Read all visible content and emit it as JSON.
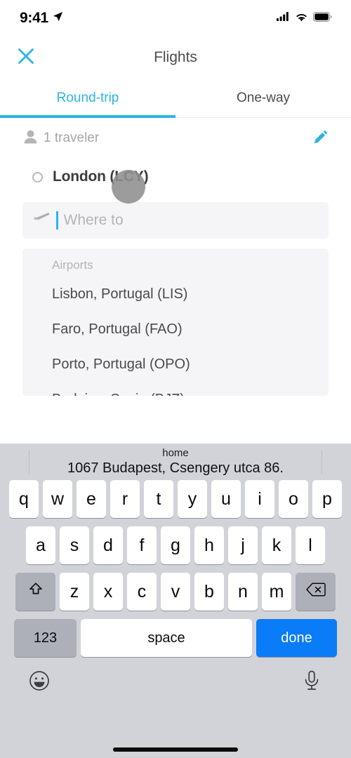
{
  "status_bar": {
    "time": "9:41",
    "location_icon": "location-arrow-icon",
    "cellular_icon": "cellular-signal-icon",
    "wifi_icon": "wifi-icon",
    "battery_icon": "battery-full-icon"
  },
  "nav": {
    "title": "Flights",
    "close_icon": "close-x-icon"
  },
  "tabs": {
    "items": [
      {
        "label": "Round-trip",
        "active": true
      },
      {
        "label": "One-way",
        "active": false
      }
    ],
    "active_color": "#29b6e8",
    "inactive_color": "#4c4c4c"
  },
  "traveler": {
    "icon": "person-icon",
    "label": "1 traveler",
    "edit_icon": "pencil-edit-icon"
  },
  "origin": {
    "marker_icon": "circle-marker-icon",
    "label": "London (LCY)"
  },
  "destination": {
    "icon": "airplane-icon",
    "placeholder": "Where to",
    "value": "",
    "caret_color": "#29b6e8"
  },
  "suggestions": {
    "section_title": "Airports",
    "items": [
      {
        "label": "Lisbon, Portugal (LIS)"
      },
      {
        "label": "Faro, Portugal (FAO)"
      },
      {
        "label": "Porto, Portugal (OPO)"
      },
      {
        "label": "Badajoz, Spain (BJZ)"
      }
    ]
  },
  "keyboard": {
    "suggestion": {
      "title": "home",
      "subtitle": "1067 Budapest, Csengery utca 86."
    },
    "row1": [
      "q",
      "w",
      "e",
      "r",
      "t",
      "y",
      "u",
      "i",
      "o",
      "p"
    ],
    "row2": [
      "a",
      "s",
      "d",
      "f",
      "g",
      "h",
      "j",
      "k",
      "l"
    ],
    "row3": [
      "z",
      "x",
      "c",
      "v",
      "b",
      "n",
      "m"
    ],
    "shift_icon": "shift-arrow-icon",
    "delete_icon": "backspace-delete-icon",
    "numbers_label": "123",
    "space_label": "space",
    "done_label": "done",
    "done_color": "#0a7cf7",
    "emoji_icon": "emoji-smiley-icon",
    "mic_icon": "microphone-icon",
    "home_indicator": "home-indicator-bar"
  },
  "overlay": {
    "touch_indicator": "touch-point-indicator"
  }
}
